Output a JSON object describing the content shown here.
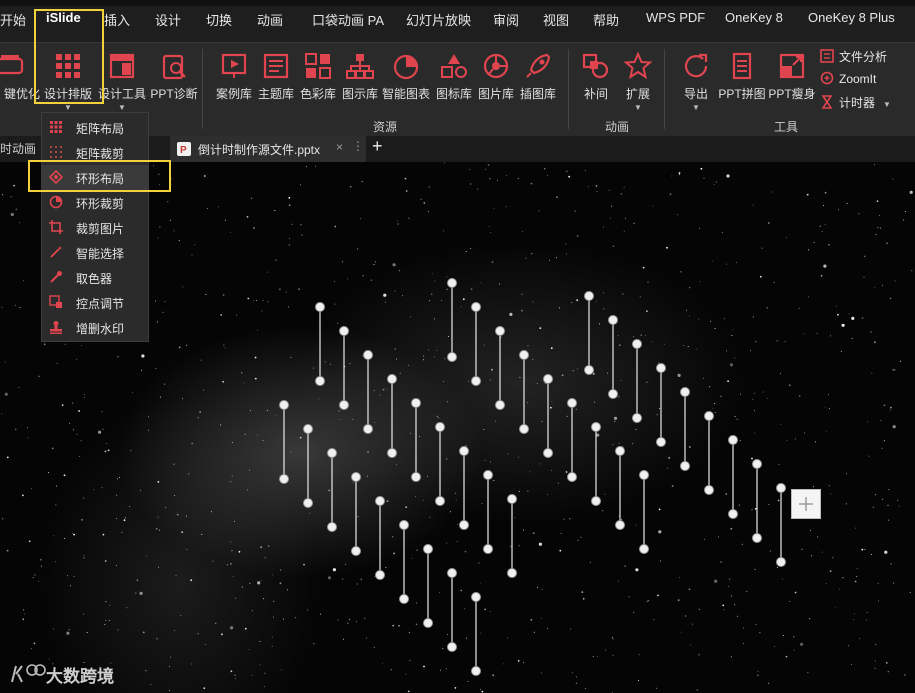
{
  "menu": {
    "tabs": [
      "开始",
      "iSlide",
      "插入",
      "设计",
      "切换",
      "动画",
      "口袋动画 PA",
      "幻灯片放映",
      "审阅",
      "视图",
      "帮助",
      "WPS PDF",
      "OneKey 8",
      "OneKey 8 Plus"
    ],
    "active_tab": "iSlide"
  },
  "ribbon": {
    "buttons": {
      "one_click": "键优化",
      "design_layout": "设计排版",
      "design_tools": "设计工具",
      "ppt_diagnose": "PPT诊断",
      "case_lib": "案例库",
      "theme_lib": "主题库",
      "color_lib": "色彩库",
      "diagram_lib": "图示库",
      "smart_chart": "智能图表",
      "icon_lib": "图标库",
      "image_lib": "图片库",
      "illustration_lib": "插图库",
      "tween": "补间",
      "extend": "扩展",
      "export": "导出",
      "ppt_stitch": "PPT拼图",
      "ppt_slim": "PPT瘦身"
    },
    "side_items": {
      "file_analysis": "文件分析",
      "zoomit": "ZoomIt",
      "timer": "计时器"
    },
    "groups": {
      "resources": "资源",
      "animation": "动画",
      "tools": "工具"
    }
  },
  "docbar": {
    "left_tab": "时动画",
    "file_tab": "倒计时制作源文件.pptx",
    "add_label": "+"
  },
  "dropdown": {
    "items": [
      "矩阵布局",
      "矩阵裁剪",
      "环形布局",
      "环形裁剪",
      "裁剪图片",
      "智能选择",
      "取色器",
      "控点调节",
      "增删水印"
    ],
    "highlighted": "环形布局"
  },
  "watermark": {
    "text": "大数跨境"
  },
  "colors": {
    "accent": "#e0454f",
    "highlight": "#f2d23c",
    "menubar": "#1e1e1e",
    "ribbon": "#2a2a2a"
  }
}
